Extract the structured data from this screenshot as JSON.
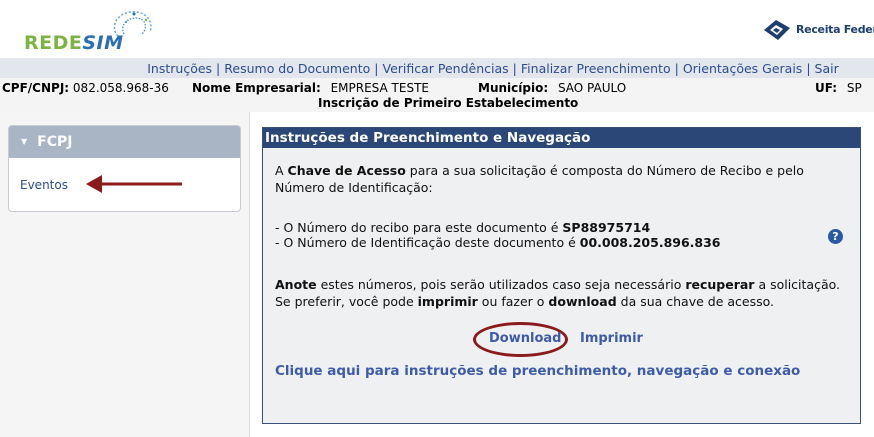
{
  "header": {
    "brand_logo": {
      "part1": "REDE",
      "part2": "SIM"
    },
    "agency_logo": "Receita Federal"
  },
  "nav": {
    "items": [
      "Instruções",
      "Resumo do Documento",
      "Verificar Pendências",
      "Finalizar Preenchimento",
      "Orientações Gerais",
      "Sair"
    ]
  },
  "info": {
    "cpf_label": "CPF/CNPJ:",
    "cpf_value": "082.058.968-36",
    "nome_label": "Nome Empresarial:",
    "nome_value": "EMPRESA TESTE",
    "municipio_label": "Município:",
    "municipio_value": "SAO PAULO",
    "uf_label": "UF:",
    "uf_value": "SP",
    "subtitle": "Inscrição de Primeiro Estabelecimento"
  },
  "sidebar": {
    "title": "FCPJ",
    "items": [
      {
        "label": "Eventos"
      }
    ]
  },
  "main": {
    "title": "Instruções de Preenchimento e Navegação",
    "intro_pre": "A ",
    "intro_bold": "Chave de Acesso",
    "intro_post": " para a sua solicitação é composta do Número de Recibo e pelo Número de Identificação:",
    "recibo_label": "- O Número do recibo para este documento é ",
    "recibo_value": "SP88975714",
    "ident_label": "- O Número de Identificação deste documento é ",
    "ident_value": "00.008.205.896.836",
    "note_b1": "Anote",
    "note_t1": " estes números, pois serão utilizados caso seja necessário ",
    "note_b2": "recuperar",
    "note_t2": " a solicitação. Se preferir, você pode ",
    "note_b3": "imprimir",
    "note_t3": " ou fazer o ",
    "note_b4": "download",
    "note_t4": " da sua chave de acesso.",
    "download_label": "Download",
    "print_label": "Imprimir",
    "help_link": "Clique aqui para instruções de preenchimento, navegação e conexão"
  },
  "colors": {
    "header_blue": "#2b4777",
    "link_blue": "#3d5ba8",
    "annotation_red": "#8b1a1a"
  }
}
